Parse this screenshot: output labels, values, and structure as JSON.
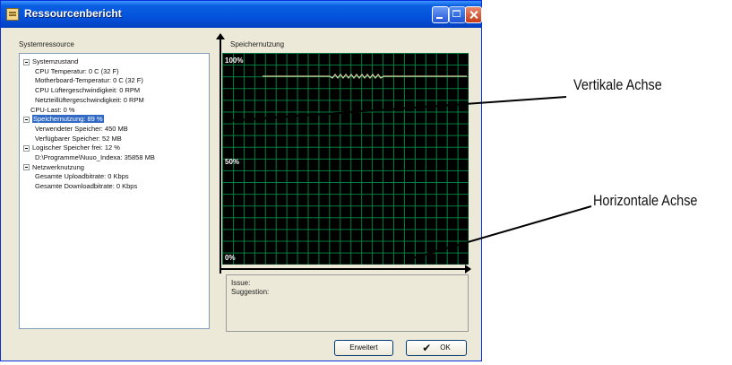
{
  "window": {
    "title": "Ressourcenbericht"
  },
  "left_panel": {
    "label": "Systemressource"
  },
  "tree": [
    {
      "label": "Systemzustand",
      "level": 0,
      "expander": true,
      "selected": false
    },
    {
      "label": "CPU Temperatur: 0 C (32 F)",
      "level": 2,
      "expander": false,
      "selected": false
    },
    {
      "label": "Motherboard-Temperatur: 0 C (32 F)",
      "level": 2,
      "expander": false,
      "selected": false
    },
    {
      "label": "CPU Lüftergeschwindigkeit: 0 RPM",
      "level": 2,
      "expander": false,
      "selected": false
    },
    {
      "label": "Netzteillüftergeschwindigkeit: 0 RPM",
      "level": 2,
      "expander": false,
      "selected": false
    },
    {
      "label": "CPU-Last: 0 %",
      "level": 1,
      "expander": false,
      "selected": false
    },
    {
      "label": "Speichernutzung: 89 %",
      "level": 0,
      "expander": true,
      "selected": true
    },
    {
      "label": "Verwendeter Speicher: 450 MB",
      "level": 2,
      "expander": false,
      "selected": false
    },
    {
      "label": "Verfügbarer Speicher: 52 MB",
      "level": 2,
      "expander": false,
      "selected": false
    },
    {
      "label": "Logischer Speicher frei: 12 %",
      "level": 0,
      "expander": true,
      "selected": false
    },
    {
      "label": "D:\\Programme\\Nuuo_Indexa: 35858 MB",
      "level": 2,
      "expander": false,
      "selected": false
    },
    {
      "label": "Netzwerknutzung",
      "level": 0,
      "expander": true,
      "selected": false
    },
    {
      "label": "Gesamte Uploadbitrate: 0 Kbps",
      "level": 2,
      "expander": false,
      "selected": false
    },
    {
      "label": "Gesamte Downloadbitrate: 0 Kbps",
      "level": 2,
      "expander": false,
      "selected": false
    }
  ],
  "graph": {
    "label": "Speichernutzung",
    "y_labels": {
      "top": "100%",
      "mid": "50%",
      "bottom": "0%"
    },
    "line_color": "#d8cfa0",
    "grid_color": "#008040",
    "memory_usage_percent": 89
  },
  "issue_panel": {
    "issue": "Issue:",
    "suggestion": "Suggestion:"
  },
  "buttons": {
    "advanced": "Erweitert",
    "ok": "OK"
  },
  "annotations": {
    "vertical_axis": "Vertikale Achse",
    "horizontal_axis": "Horizontale Achse"
  }
}
